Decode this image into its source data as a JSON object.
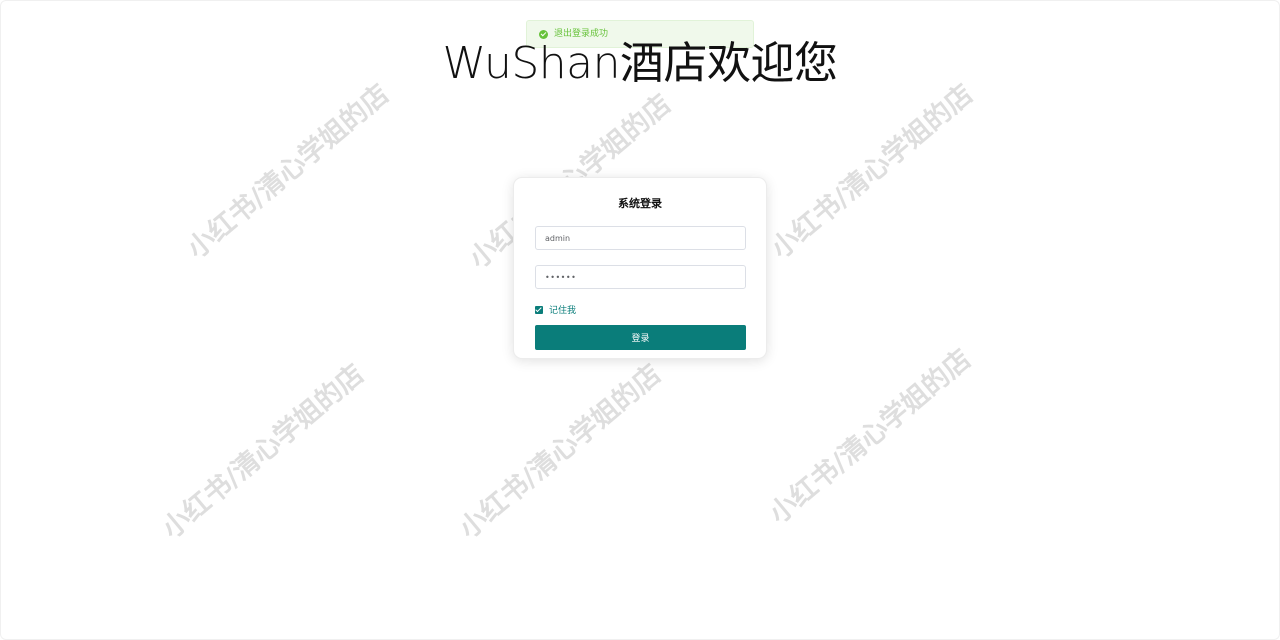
{
  "toast": {
    "message": "退出登录成功",
    "icon": "success-check-icon",
    "color": "#67c23a"
  },
  "header": {
    "title": "WuShan酒店欢迎您"
  },
  "login": {
    "title": "系统登录",
    "username_value": "admin",
    "password_value": "••••••",
    "remember_label": "记住我",
    "remember_checked": true,
    "submit_label": "登录",
    "accent_color": "#0a7d7a"
  },
  "watermark": {
    "text": "小红书/清心学姐的店"
  }
}
